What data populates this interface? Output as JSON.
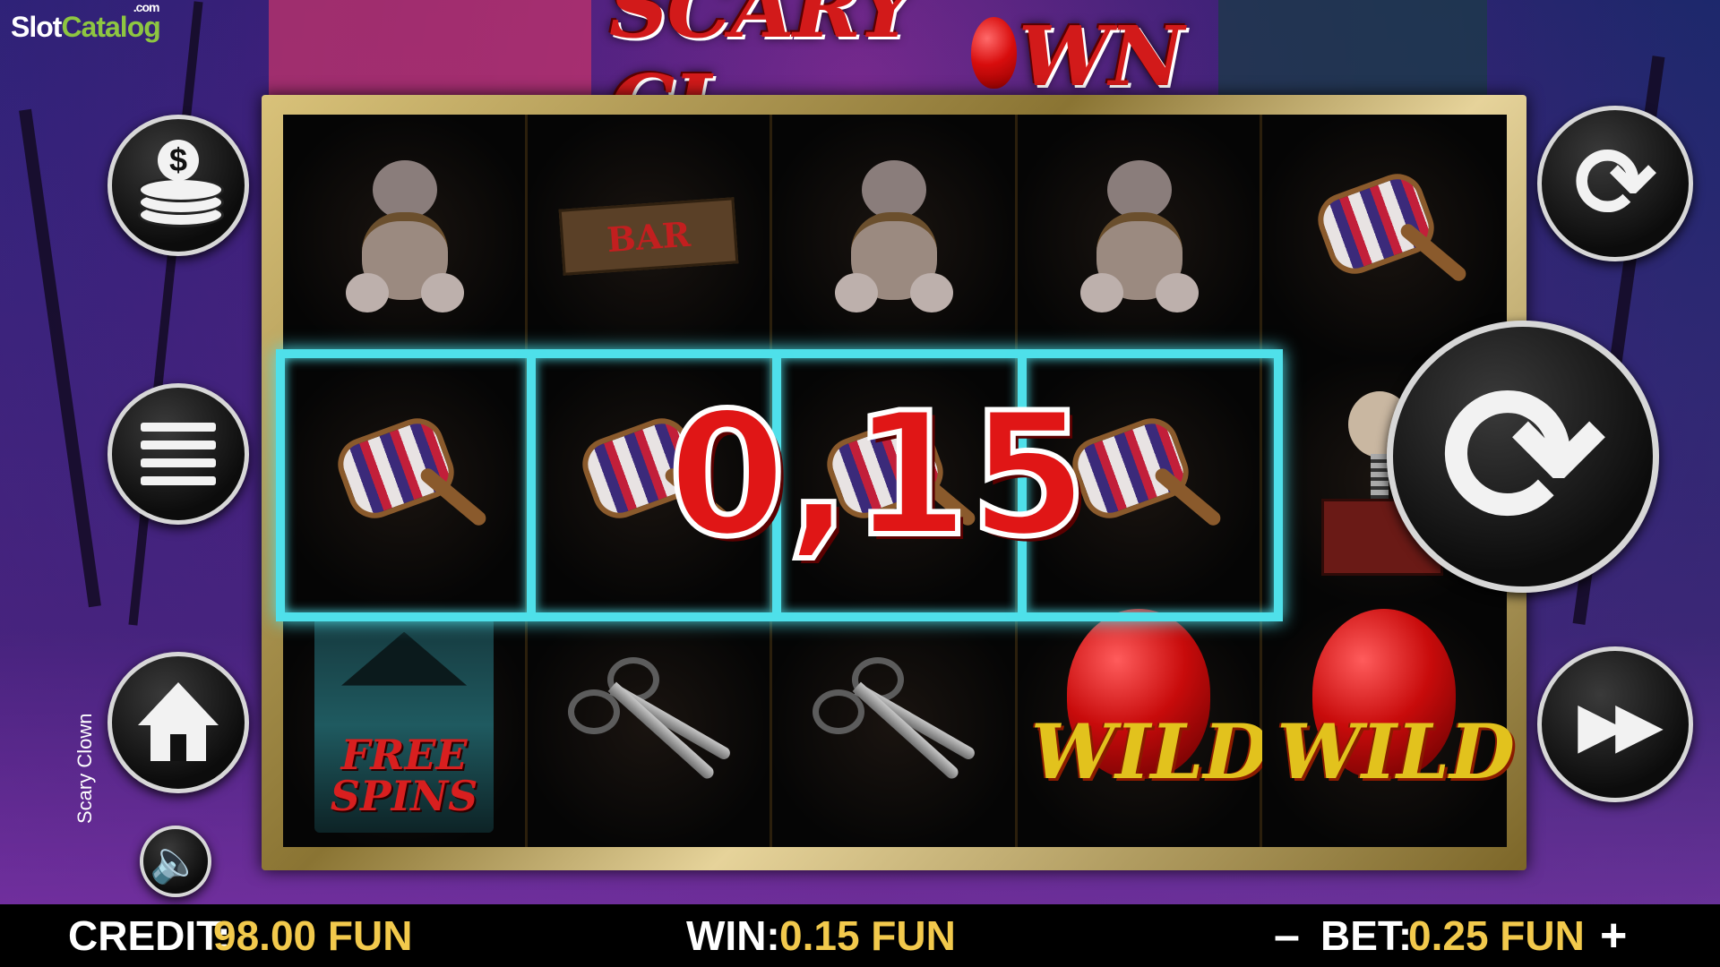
{
  "brand": {
    "part1": "Slot",
    "part2": "Catalog",
    "suffix": ".com"
  },
  "game": {
    "title_left": "SCARY CL",
    "title_right": "WN",
    "side_title": "Scary Clown"
  },
  "reels": {
    "rows": [
      [
        "teddy-bear",
        "bar-sign",
        "teddy-bear",
        "teddy-bear",
        "mallet"
      ],
      [
        "mallet",
        "mallet",
        "mallet",
        "mallet",
        "jack-in-the-box"
      ],
      [
        "free-spins",
        "scissors",
        "scissors",
        "wild-balloon",
        "wild-balloon"
      ]
    ],
    "bar_label": "BAR",
    "free_spins_label": "FREE SPINS",
    "wild_label": "WILD"
  },
  "win_overlay": {
    "amount": "0,15",
    "line_color": "#4fe0ea"
  },
  "buttons": {
    "coins": "coins-icon",
    "menu": "menu-icon",
    "home": "home-icon",
    "sound": "speaker-icon",
    "autoplay": "refresh-icon",
    "spin": "spin-icon",
    "turbo": "fast-forward-icon"
  },
  "status": {
    "credit_label": "CREDIT:",
    "credit_value": "98.00 FUN",
    "win_label": "WIN:",
    "win_value": "0.15 FUN",
    "bet_minus": "–",
    "bet_label": "BET:",
    "bet_value": "0.25 FUN",
    "bet_plus": "+"
  },
  "colors": {
    "accent_gold": "#f2c94c",
    "logo_red": "#d21a1a",
    "wild_yellow": "#e2c21d"
  }
}
